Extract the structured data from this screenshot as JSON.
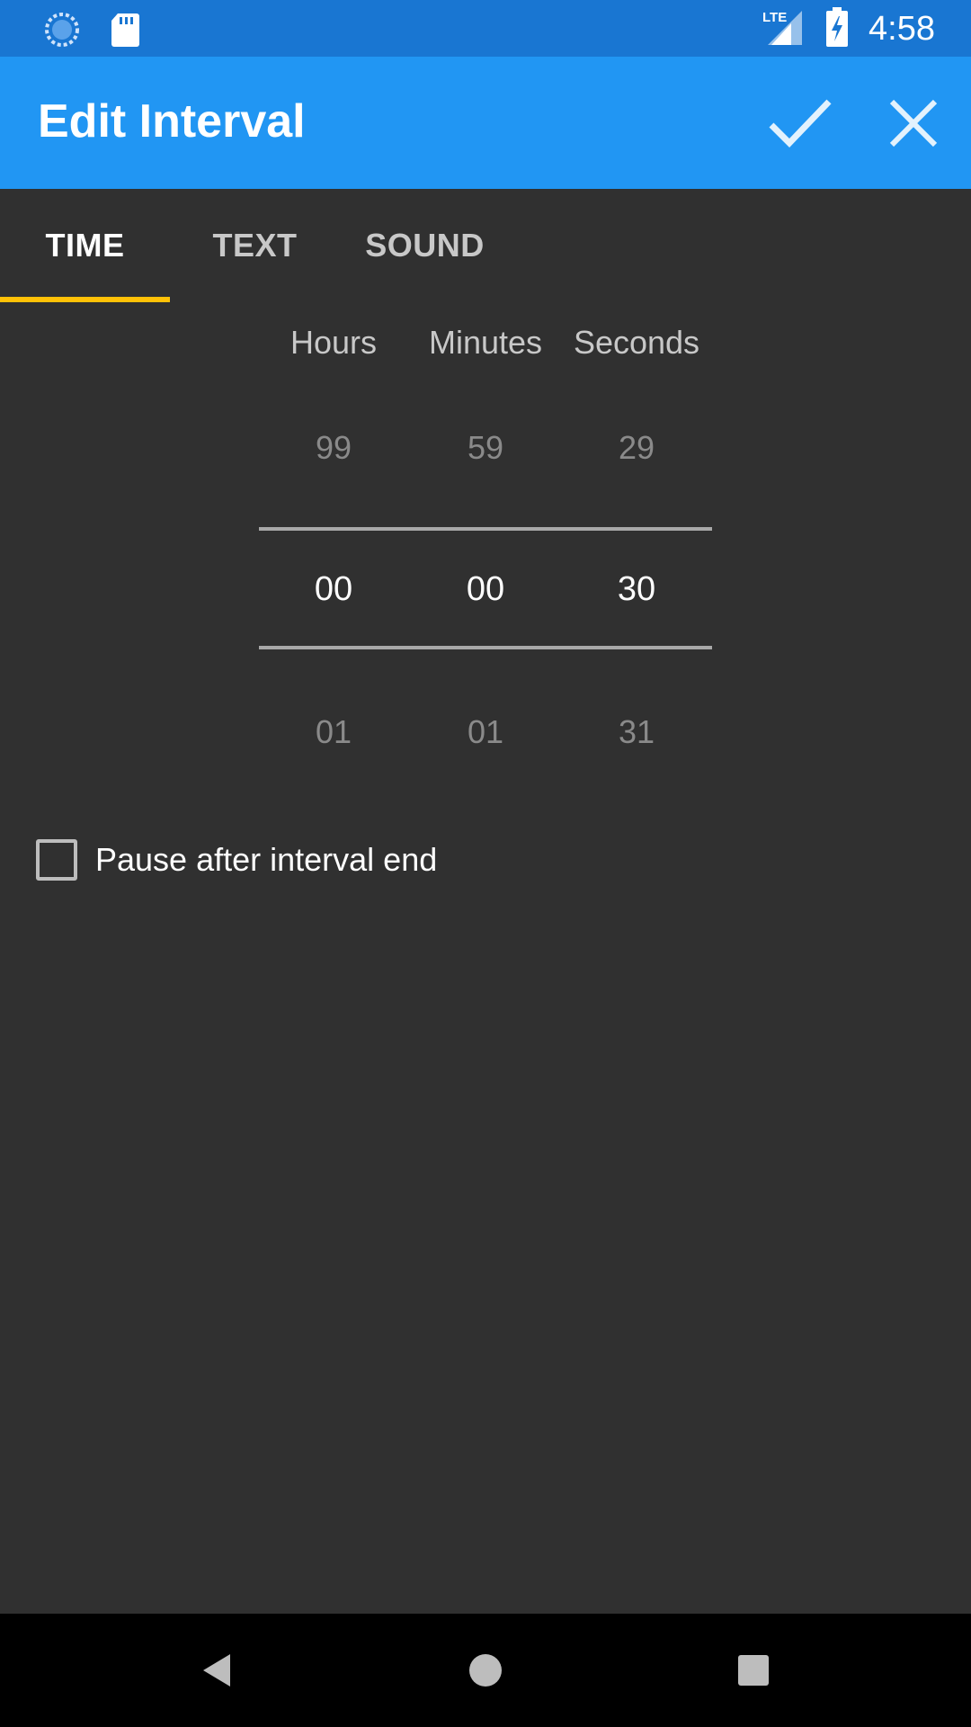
{
  "status_bar": {
    "time": "4:58",
    "network": "LTE",
    "icons": [
      "sync-icon",
      "sd-card-icon",
      "lte-signal-icon",
      "battery-charging-icon"
    ]
  },
  "app_bar": {
    "title": "Edit Interval",
    "confirm_icon": "check-icon",
    "close_icon": "close-icon",
    "background": "#2196F3"
  },
  "tabs": [
    {
      "label": "TIME",
      "active": true
    },
    {
      "label": "TEXT",
      "active": false
    },
    {
      "label": "SOUND",
      "active": false
    }
  ],
  "picker": {
    "headers": {
      "hours": "Hours",
      "minutes": "Minutes",
      "seconds": "Seconds"
    },
    "prev": {
      "hours": "99",
      "minutes": "59",
      "seconds": "29"
    },
    "current": {
      "hours": "00",
      "minutes": "00",
      "seconds": "30"
    },
    "next": {
      "hours": "01",
      "minutes": "01",
      "seconds": "31"
    }
  },
  "pause_option": {
    "label": "Pause after interval end",
    "checked": false
  },
  "colors": {
    "accent": "#FFC107",
    "status_bar": "#1976D2",
    "background": "#303030"
  }
}
